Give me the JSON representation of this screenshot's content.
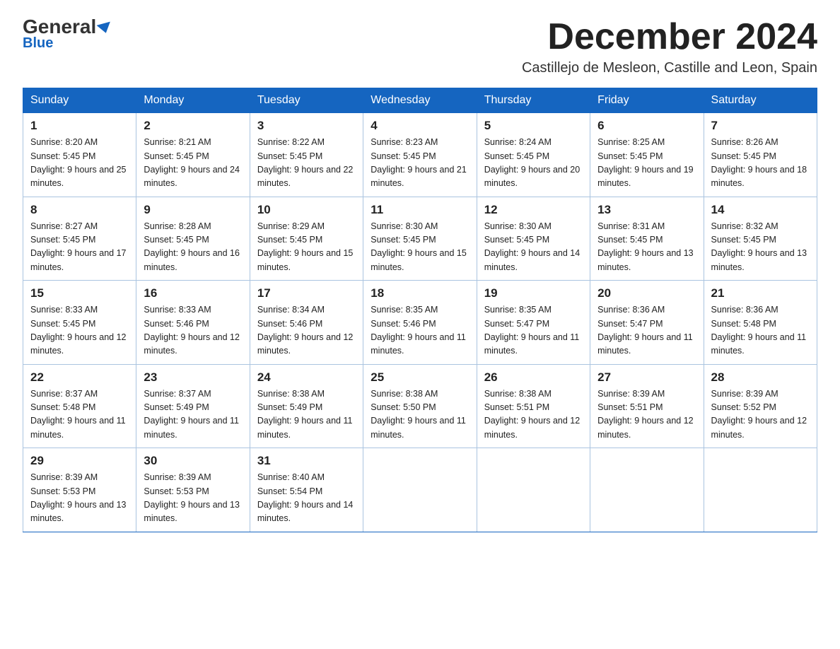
{
  "header": {
    "logo_general": "General",
    "logo_blue": "Blue",
    "month_title": "December 2024",
    "location": "Castillejo de Mesleon, Castille and Leon, Spain"
  },
  "days_of_week": [
    "Sunday",
    "Monday",
    "Tuesday",
    "Wednesday",
    "Thursday",
    "Friday",
    "Saturday"
  ],
  "weeks": [
    [
      {
        "day": 1,
        "sunrise": "8:20 AM",
        "sunset": "5:45 PM",
        "daylight": "9 hours and 25 minutes."
      },
      {
        "day": 2,
        "sunrise": "8:21 AM",
        "sunset": "5:45 PM",
        "daylight": "9 hours and 24 minutes."
      },
      {
        "day": 3,
        "sunrise": "8:22 AM",
        "sunset": "5:45 PM",
        "daylight": "9 hours and 22 minutes."
      },
      {
        "day": 4,
        "sunrise": "8:23 AM",
        "sunset": "5:45 PM",
        "daylight": "9 hours and 21 minutes."
      },
      {
        "day": 5,
        "sunrise": "8:24 AM",
        "sunset": "5:45 PM",
        "daylight": "9 hours and 20 minutes."
      },
      {
        "day": 6,
        "sunrise": "8:25 AM",
        "sunset": "5:45 PM",
        "daylight": "9 hours and 19 minutes."
      },
      {
        "day": 7,
        "sunrise": "8:26 AM",
        "sunset": "5:45 PM",
        "daylight": "9 hours and 18 minutes."
      }
    ],
    [
      {
        "day": 8,
        "sunrise": "8:27 AM",
        "sunset": "5:45 PM",
        "daylight": "9 hours and 17 minutes."
      },
      {
        "day": 9,
        "sunrise": "8:28 AM",
        "sunset": "5:45 PM",
        "daylight": "9 hours and 16 minutes."
      },
      {
        "day": 10,
        "sunrise": "8:29 AM",
        "sunset": "5:45 PM",
        "daylight": "9 hours and 15 minutes."
      },
      {
        "day": 11,
        "sunrise": "8:30 AM",
        "sunset": "5:45 PM",
        "daylight": "9 hours and 15 minutes."
      },
      {
        "day": 12,
        "sunrise": "8:30 AM",
        "sunset": "5:45 PM",
        "daylight": "9 hours and 14 minutes."
      },
      {
        "day": 13,
        "sunrise": "8:31 AM",
        "sunset": "5:45 PM",
        "daylight": "9 hours and 13 minutes."
      },
      {
        "day": 14,
        "sunrise": "8:32 AM",
        "sunset": "5:45 PM",
        "daylight": "9 hours and 13 minutes."
      }
    ],
    [
      {
        "day": 15,
        "sunrise": "8:33 AM",
        "sunset": "5:45 PM",
        "daylight": "9 hours and 12 minutes."
      },
      {
        "day": 16,
        "sunrise": "8:33 AM",
        "sunset": "5:46 PM",
        "daylight": "9 hours and 12 minutes."
      },
      {
        "day": 17,
        "sunrise": "8:34 AM",
        "sunset": "5:46 PM",
        "daylight": "9 hours and 12 minutes."
      },
      {
        "day": 18,
        "sunrise": "8:35 AM",
        "sunset": "5:46 PM",
        "daylight": "9 hours and 11 minutes."
      },
      {
        "day": 19,
        "sunrise": "8:35 AM",
        "sunset": "5:47 PM",
        "daylight": "9 hours and 11 minutes."
      },
      {
        "day": 20,
        "sunrise": "8:36 AM",
        "sunset": "5:47 PM",
        "daylight": "9 hours and 11 minutes."
      },
      {
        "day": 21,
        "sunrise": "8:36 AM",
        "sunset": "5:48 PM",
        "daylight": "9 hours and 11 minutes."
      }
    ],
    [
      {
        "day": 22,
        "sunrise": "8:37 AM",
        "sunset": "5:48 PM",
        "daylight": "9 hours and 11 minutes."
      },
      {
        "day": 23,
        "sunrise": "8:37 AM",
        "sunset": "5:49 PM",
        "daylight": "9 hours and 11 minutes."
      },
      {
        "day": 24,
        "sunrise": "8:38 AM",
        "sunset": "5:49 PM",
        "daylight": "9 hours and 11 minutes."
      },
      {
        "day": 25,
        "sunrise": "8:38 AM",
        "sunset": "5:50 PM",
        "daylight": "9 hours and 11 minutes."
      },
      {
        "day": 26,
        "sunrise": "8:38 AM",
        "sunset": "5:51 PM",
        "daylight": "9 hours and 12 minutes."
      },
      {
        "day": 27,
        "sunrise": "8:39 AM",
        "sunset": "5:51 PM",
        "daylight": "9 hours and 12 minutes."
      },
      {
        "day": 28,
        "sunrise": "8:39 AM",
        "sunset": "5:52 PM",
        "daylight": "9 hours and 12 minutes."
      }
    ],
    [
      {
        "day": 29,
        "sunrise": "8:39 AM",
        "sunset": "5:53 PM",
        "daylight": "9 hours and 13 minutes."
      },
      {
        "day": 30,
        "sunrise": "8:39 AM",
        "sunset": "5:53 PM",
        "daylight": "9 hours and 13 minutes."
      },
      {
        "day": 31,
        "sunrise": "8:40 AM",
        "sunset": "5:54 PM",
        "daylight": "9 hours and 14 minutes."
      },
      null,
      null,
      null,
      null
    ]
  ]
}
